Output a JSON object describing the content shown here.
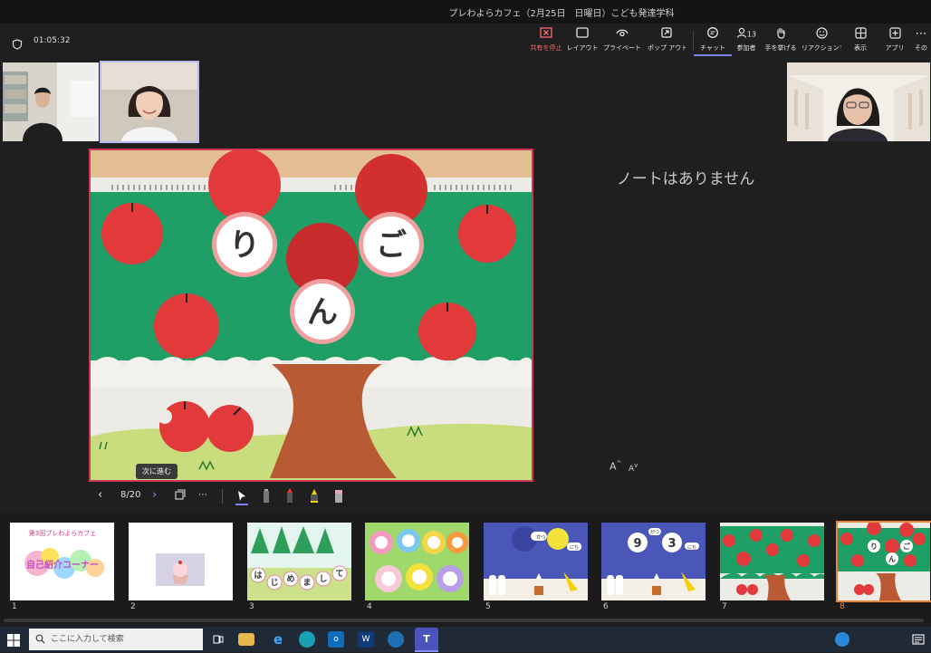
{
  "window": {
    "title": "プレわよらカフェ（2月25日　日曜日）こども発達学科"
  },
  "call": {
    "timer": "01:05:32"
  },
  "toolbar": {
    "items": [
      {
        "label": "共有を停止",
        "icon": "stop-share-icon"
      },
      {
        "label": "レイアウト",
        "icon": "layout-icon"
      },
      {
        "label": "プライベート ビ...",
        "icon": "private-view-icon"
      },
      {
        "label": "ポップ アウト",
        "icon": "pop-out-icon"
      },
      {
        "label": "チャット",
        "icon": "chat-icon"
      },
      {
        "label": "参加者",
        "icon": "participants-icon",
        "count": "13"
      },
      {
        "label": "手を挙げる",
        "icon": "raise-hand-icon"
      },
      {
        "label": "リアクションする",
        "icon": "reaction-icon"
      },
      {
        "label": "表示",
        "icon": "view-icon"
      },
      {
        "label": "アプリ",
        "icon": "apps-icon"
      },
      {
        "label": "その",
        "icon": "more-icon"
      }
    ]
  },
  "slide": {
    "chars": [
      "り",
      "ご",
      "ん"
    ],
    "notes": "ノートはありません",
    "font_increase": "A",
    "font_decrease": "A",
    "tooltip": "次に進む",
    "counter": "8/20"
  },
  "thumbnails": {
    "numbers": [
      "1",
      "2",
      "3",
      "4",
      "5",
      "6",
      "7",
      "8"
    ],
    "t1_title": "第3回プレわよらカフェ",
    "t1_sub": "自己紹介コーナー",
    "t3_text": [
      "は",
      "じ",
      "め",
      "ま",
      "し",
      "て"
    ],
    "t5_chars": [
      "か",
      "つ",
      "にち"
    ],
    "t6_chars": [
      "9",
      "がつ",
      "3",
      "にち"
    ],
    "t8_chars": [
      "り",
      "ご",
      "ん"
    ]
  },
  "taskbar": {
    "search_placeholder": "ここに入力して検索"
  },
  "colors": {
    "accent": "#7b83eb",
    "stop": "#ff6b6b",
    "slide_border": "#d0345a",
    "selected_thumb": "#e6863a"
  }
}
